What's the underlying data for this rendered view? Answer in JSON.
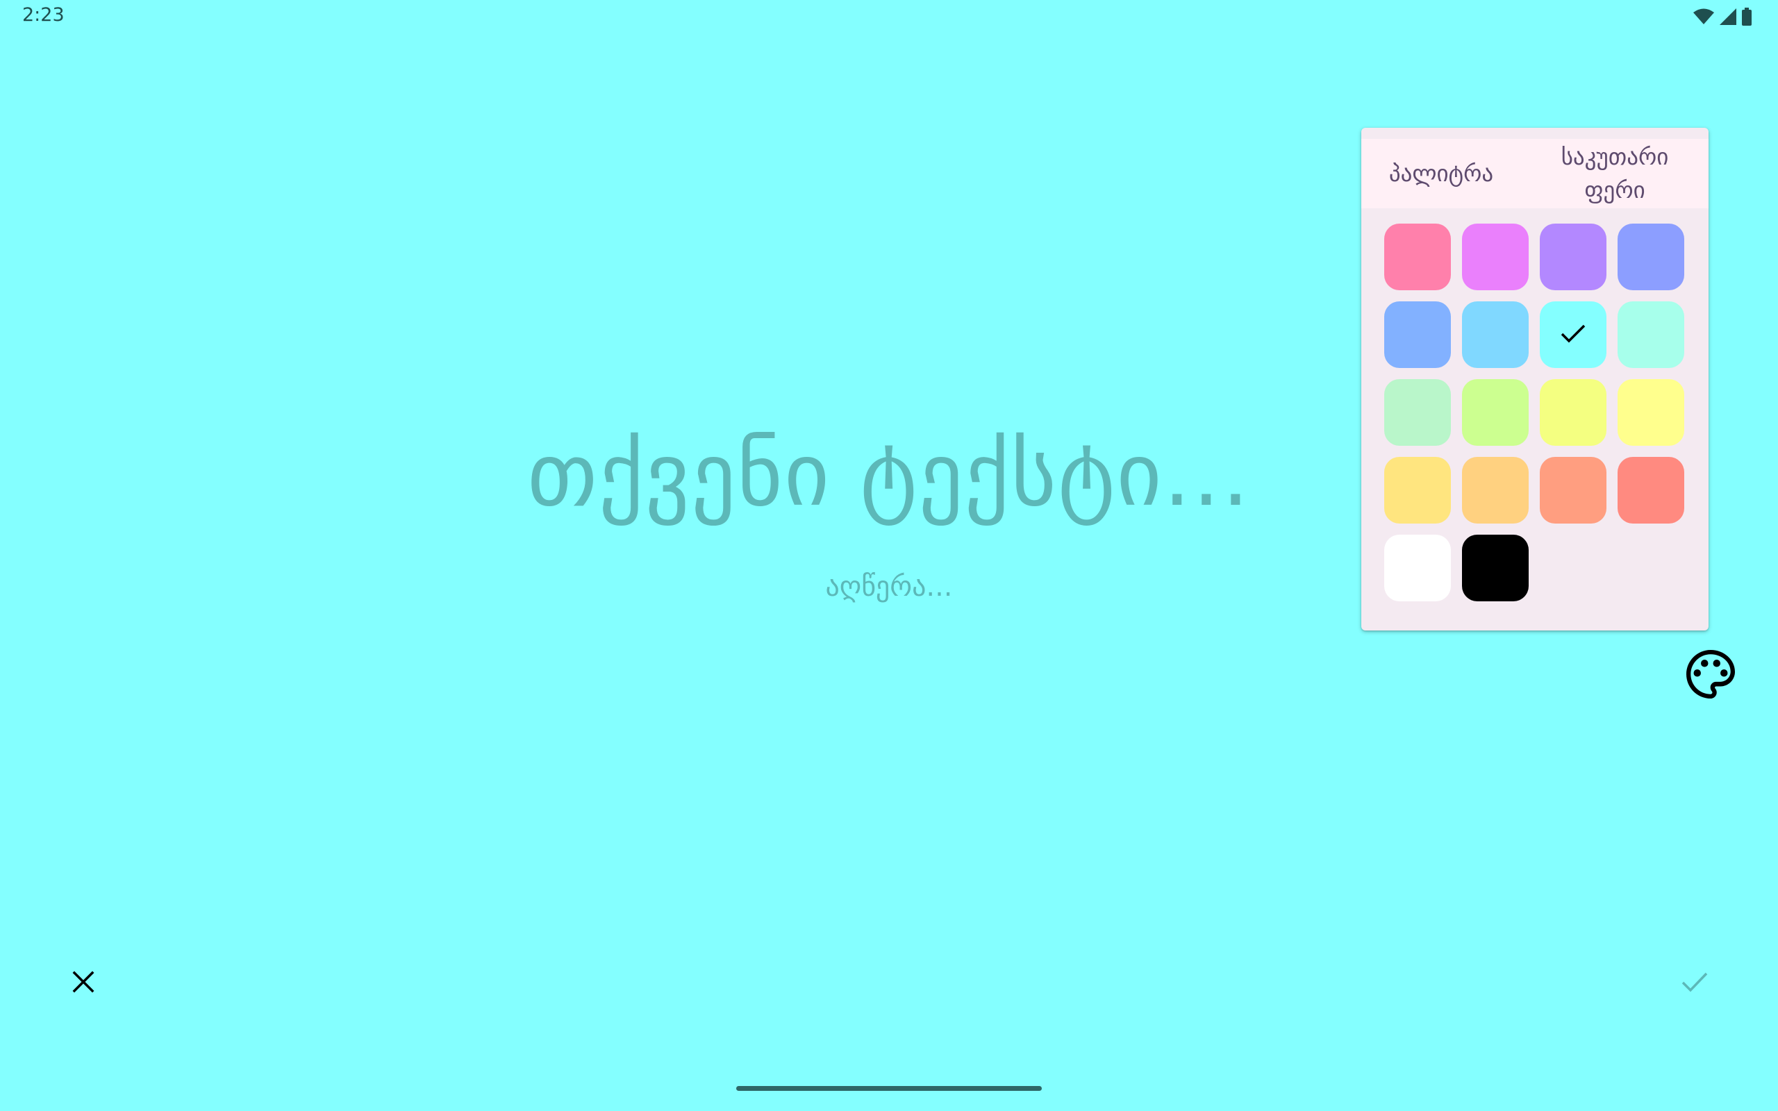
{
  "status_bar": {
    "time": "2:23",
    "icons": [
      "wifi-icon",
      "signal-icon",
      "battery-icon"
    ]
  },
  "editor": {
    "title_placeholder": "თქვენი ტექსტი...",
    "description_placeholder": "აღწერა..."
  },
  "color_picker": {
    "tabs": [
      {
        "label": "პალიტრა"
      },
      {
        "label": "საკუთარი ფერი"
      }
    ],
    "selected_index": 6,
    "swatches": [
      {
        "color": "#FF80AB"
      },
      {
        "color": "#EA80FC"
      },
      {
        "color": "#B388FF"
      },
      {
        "color": "#8C9EFF"
      },
      {
        "color": "#82B1FF"
      },
      {
        "color": "#80D8FF"
      },
      {
        "color": "#84FFFF"
      },
      {
        "color": "#A7FFEB"
      },
      {
        "color": "#B9F6CA"
      },
      {
        "color": "#CCFF90"
      },
      {
        "color": "#F4FF81"
      },
      {
        "color": "#FFFF8D"
      },
      {
        "color": "#FFE57F"
      },
      {
        "color": "#FFD180"
      },
      {
        "color": "#FF9E80"
      },
      {
        "color": "#FF8A80"
      },
      {
        "color": "#FFFFFF"
      },
      {
        "color": "#000000"
      }
    ]
  },
  "actions": {
    "palette_icon": "palette-icon",
    "close_icon": "close-icon",
    "confirm_icon": "check-icon"
  },
  "colors": {
    "background": "#84FFFF",
    "placeholder_text": "#5cb8b8",
    "picker_background": "#f4eaf1"
  }
}
